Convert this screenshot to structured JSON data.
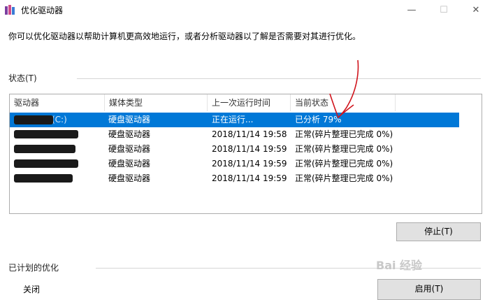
{
  "window": {
    "title": "优化驱动器",
    "minimize_glyph": "—",
    "maximize_glyph": "☐",
    "close_glyph": "✕"
  },
  "description": "你可以优化驱动器以帮助计算机更高效地运行，或者分析驱动器以了解是否需要对其进行优化。",
  "status_section": {
    "label": "状态(T)",
    "columns": [
      "驱动器",
      "媒体类型",
      "上一次运行时间",
      "当前状态"
    ],
    "rows": [
      {
        "drive": "(C:)",
        "media": "硬盘驱动器",
        "last_run": "正在运行...",
        "status": "已分析 79%"
      },
      {
        "drive": "",
        "media": "硬盘驱动器",
        "last_run": "2018/11/14 19:58",
        "status": "正常(碎片整理已完成 0%)"
      },
      {
        "drive": "",
        "media": "硬盘驱动器",
        "last_run": "2018/11/14 19:59",
        "status": "正常(碎片整理已完成 0%)"
      },
      {
        "drive": "",
        "media": "硬盘驱动器",
        "last_run": "2018/11/14 19:59",
        "status": "正常(碎片整理已完成 0%)"
      },
      {
        "drive": "",
        "media": "硬盘驱动器",
        "last_run": "2018/11/14 19:59",
        "status": "正常(碎片整理已完成 0%)"
      }
    ]
  },
  "stop_button": "停止(T)",
  "scheduled_section": {
    "label": "已计划的优化",
    "state": "关闭",
    "enable_button": "启用(T)"
  },
  "watermark": "Bai 经验",
  "colors": {
    "selection": "#0078d7",
    "annotation": "#d0141c"
  }
}
